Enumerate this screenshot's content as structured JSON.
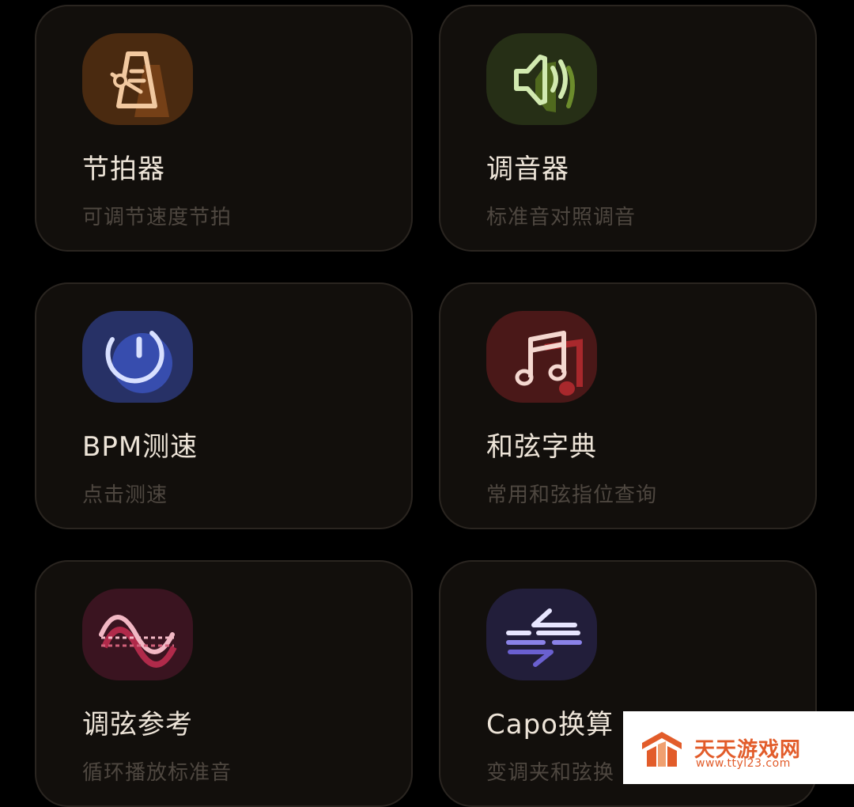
{
  "cards": [
    {
      "title": "节拍器",
      "subtitle": "可调节速度节拍",
      "icon": "metronome-icon",
      "color": "#e8a06a"
    },
    {
      "title": "调音器",
      "subtitle": "标准音对照调音",
      "icon": "speaker-tuner-icon",
      "color": "#b8d690"
    },
    {
      "title": "BPM测速",
      "subtitle": "点击测速",
      "icon": "tempo-dial-icon",
      "color": "#7a93e8"
    },
    {
      "title": "和弦字典",
      "subtitle": "常用和弦指位查询",
      "icon": "music-note-icon",
      "color": "#e07a82"
    },
    {
      "title": "调弦参考",
      "subtitle": "循环播放标准音",
      "icon": "sine-wave-icon",
      "color": "#e06b8a"
    },
    {
      "title": "Capo换算",
      "subtitle": "变调夹和弦换",
      "icon": "capo-convert-icon",
      "color": "#8a82e8"
    }
  ],
  "watermark": {
    "name": "天天游戏网",
    "url": "www.ttyl23.com",
    "color": "#e25c2a"
  }
}
